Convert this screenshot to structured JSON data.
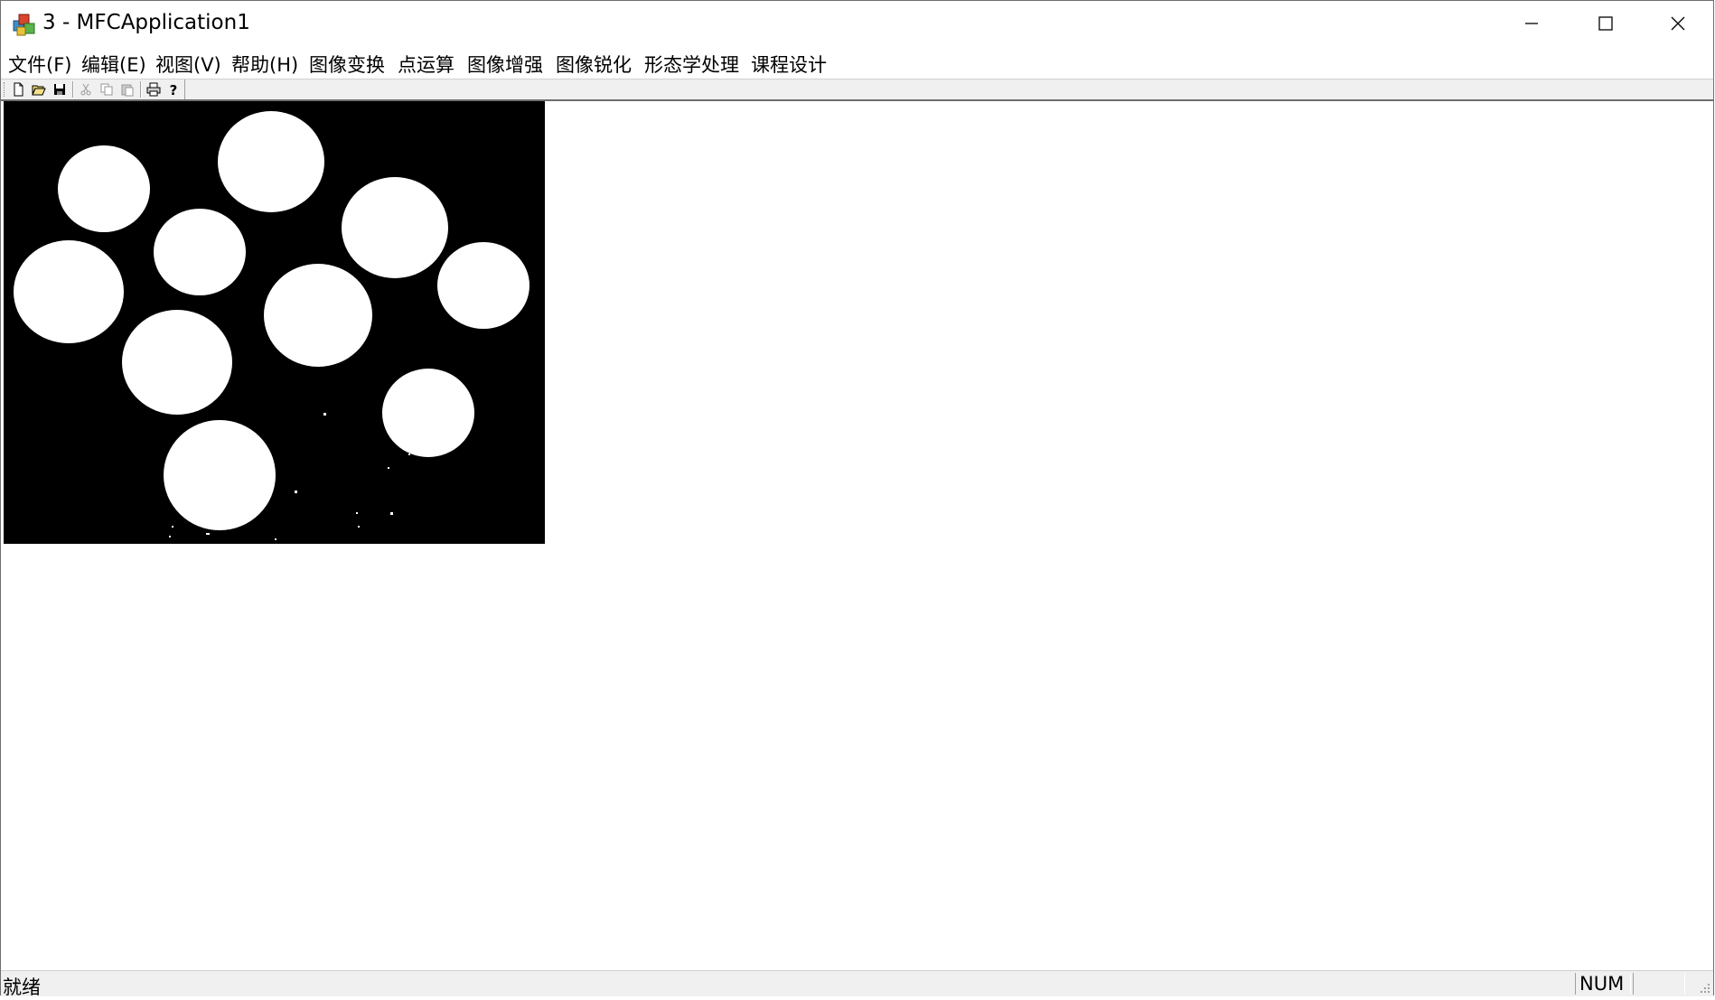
{
  "window": {
    "title": "3 - MFCApplication1",
    "icon": "mfc-app-icon",
    "controls": [
      "minimize-icon",
      "maximize-icon",
      "close-icon"
    ]
  },
  "menubar": {
    "items": [
      {
        "label": "文件(F)"
      },
      {
        "label": "编辑(E)"
      },
      {
        "label": "视图(V)"
      },
      {
        "label": "帮助(H)"
      },
      {
        "label": "图像变换"
      },
      {
        "label": "点运算"
      },
      {
        "label": "图像增强"
      },
      {
        "label": "图像锐化"
      },
      {
        "label": "形态学处理"
      },
      {
        "label": "课程设计"
      }
    ]
  },
  "toolbar": {
    "buttons": [
      {
        "icon": "new-file-icon",
        "enabled": true
      },
      {
        "icon": "open-folder-icon",
        "enabled": true
      },
      {
        "icon": "save-icon",
        "enabled": true
      },
      {
        "icon": "cut-icon",
        "enabled": false
      },
      {
        "icon": "copy-icon",
        "enabled": false
      },
      {
        "icon": "paste-icon",
        "enabled": false
      },
      {
        "icon": "print-icon",
        "enabled": true
      },
      {
        "icon": "help-icon",
        "enabled": true
      }
    ]
  },
  "content": {
    "image": "binary-image-white-circles-on-black",
    "colors": {
      "background": "#000000",
      "foreground": "#ffffff"
    }
  },
  "statusbar": {
    "text": "就绪",
    "num_indicator": "NUM"
  }
}
